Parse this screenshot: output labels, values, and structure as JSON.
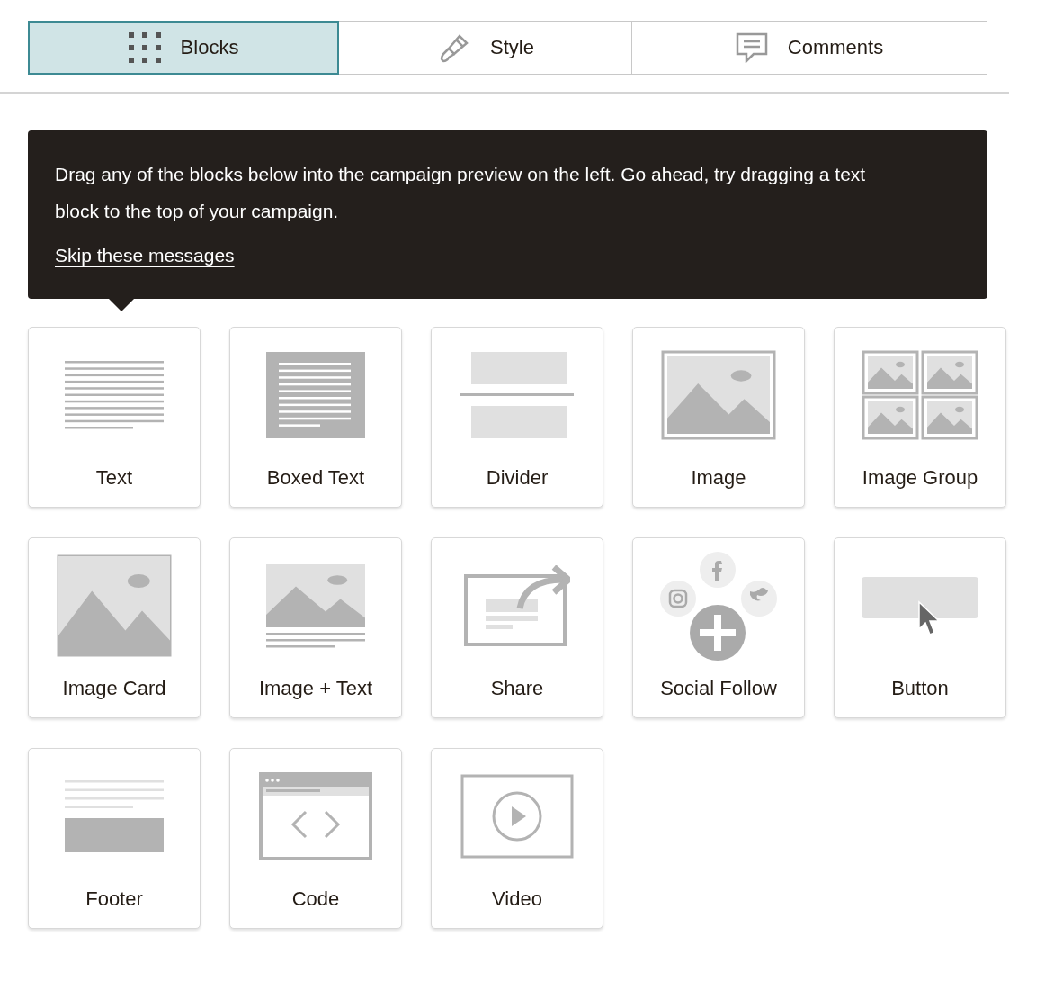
{
  "tabs": [
    {
      "label": "Blocks",
      "kind": "grid",
      "selected": true
    },
    {
      "label": "Style",
      "kind": "brush",
      "selected": false
    },
    {
      "label": "Comments",
      "kind": "comment",
      "selected": false
    }
  ],
  "tip": {
    "text": "Drag any of the blocks below into the campaign preview on the left. Go ahead, try dragging a text block to the top of your campaign.",
    "link": "Skip these messages"
  },
  "blocks": [
    {
      "label": "Text",
      "kind": "text"
    },
    {
      "label": "Boxed Text",
      "kind": "boxed"
    },
    {
      "label": "Divider",
      "kind": "divider"
    },
    {
      "label": "Image",
      "kind": "image"
    },
    {
      "label": "Image Group",
      "kind": "group"
    },
    {
      "label": "Image Card",
      "kind": "card"
    },
    {
      "label": "Image + Text",
      "kind": "imagetext"
    },
    {
      "label": "Share",
      "kind": "share"
    },
    {
      "label": "Social Follow",
      "kind": "social"
    },
    {
      "label": "Button",
      "kind": "button"
    },
    {
      "label": "Footer",
      "kind": "footer"
    },
    {
      "label": "Code",
      "kind": "code"
    },
    {
      "label": "Video",
      "kind": "video"
    }
  ]
}
